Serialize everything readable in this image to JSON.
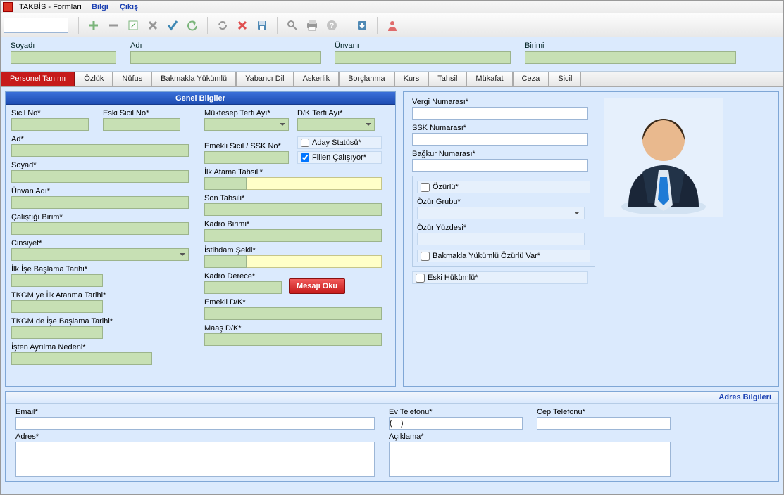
{
  "menu": {
    "title": "TAKBİS - Formları",
    "bilgi": "Bilgi",
    "cikis": "Çıkış"
  },
  "filter": {
    "soyadi": "Soyadı",
    "adi": "Adı",
    "unvani": "Ünvanı",
    "birimi": "Birimi"
  },
  "tabs": {
    "personel": "Personel Tanımı",
    "ozluk": "Özlük",
    "nufus": "Nüfus",
    "bakmakla": "Bakmakla Yükümlü",
    "yabanci": "Yabancı Dil",
    "askerlik": "Askerlik",
    "borclanma": "Borçlanma",
    "kurs": "Kurs",
    "tahsil": "Tahsil",
    "mukafat": "Mükafat",
    "ceza": "Ceza",
    "sicil": "Sicil"
  },
  "panel": {
    "genel": "Genel Bilgiler",
    "adres": "Adres Bilgileri"
  },
  "left": {
    "sicilno": "Sicil No*",
    "eskisicil": "Eski Sicil No*",
    "ad": "Ad*",
    "soyad": "Soyad*",
    "unvanadi": "Ünvan Adı*",
    "calisigi": "Çalıştığı Birim*",
    "cinsiyet": "Cinsiyet*",
    "ilkise": "İlk İşe Başlama Tarihi*",
    "tkgmilk": "TKGM ye İlk Atanma Tarihi*",
    "tkgmde": "TKGM de İşe Başlama Tarihi*",
    "ayrilma": "İşten Ayrılma Nedeni*"
  },
  "mid": {
    "muktesep": "Müktesep Terfi Ayı*",
    "dkterfi": "D/K Terfi Ayı*",
    "emeklissk": "Emekli Sicil / SSK No*",
    "ilkatama": "İlk Atama Tahsili*",
    "sontahsil": "Son Tahsili*",
    "kadrobirim": "Kadro Birimi*",
    "istihdam": "İstihdam Şekli*",
    "kadroderece": "Kadro Derece*",
    "emeklidk": "Emekli D/K*",
    "maasdk": "Maaş D/K*",
    "aday": "Aday Statüsü*",
    "fiilen": "Fiilen Çalışıyor*",
    "mesajoku": "Mesajı Oku"
  },
  "right": {
    "vergi": "Vergi Numarası*",
    "ssk": "SSK Numarası*",
    "bagkur": "Bağkur Numarası*",
    "ozurlu": "Özürlü*",
    "ozurgrubu": "Özür Grubu*",
    "ozuryuzde": "Özür Yüzdesi*",
    "bakmaklaoz": "Bakmakla Yükümlü Özürlü Var*",
    "eskihukumlu": "Eski Hükümlü*"
  },
  "addr": {
    "email": "Email*",
    "adres": "Adres*",
    "evtel": "Ev Telefonu*",
    "ceptel": "Cep Telefonu*",
    "aciklama": "Açıklama*",
    "phoneval": "(    )"
  }
}
